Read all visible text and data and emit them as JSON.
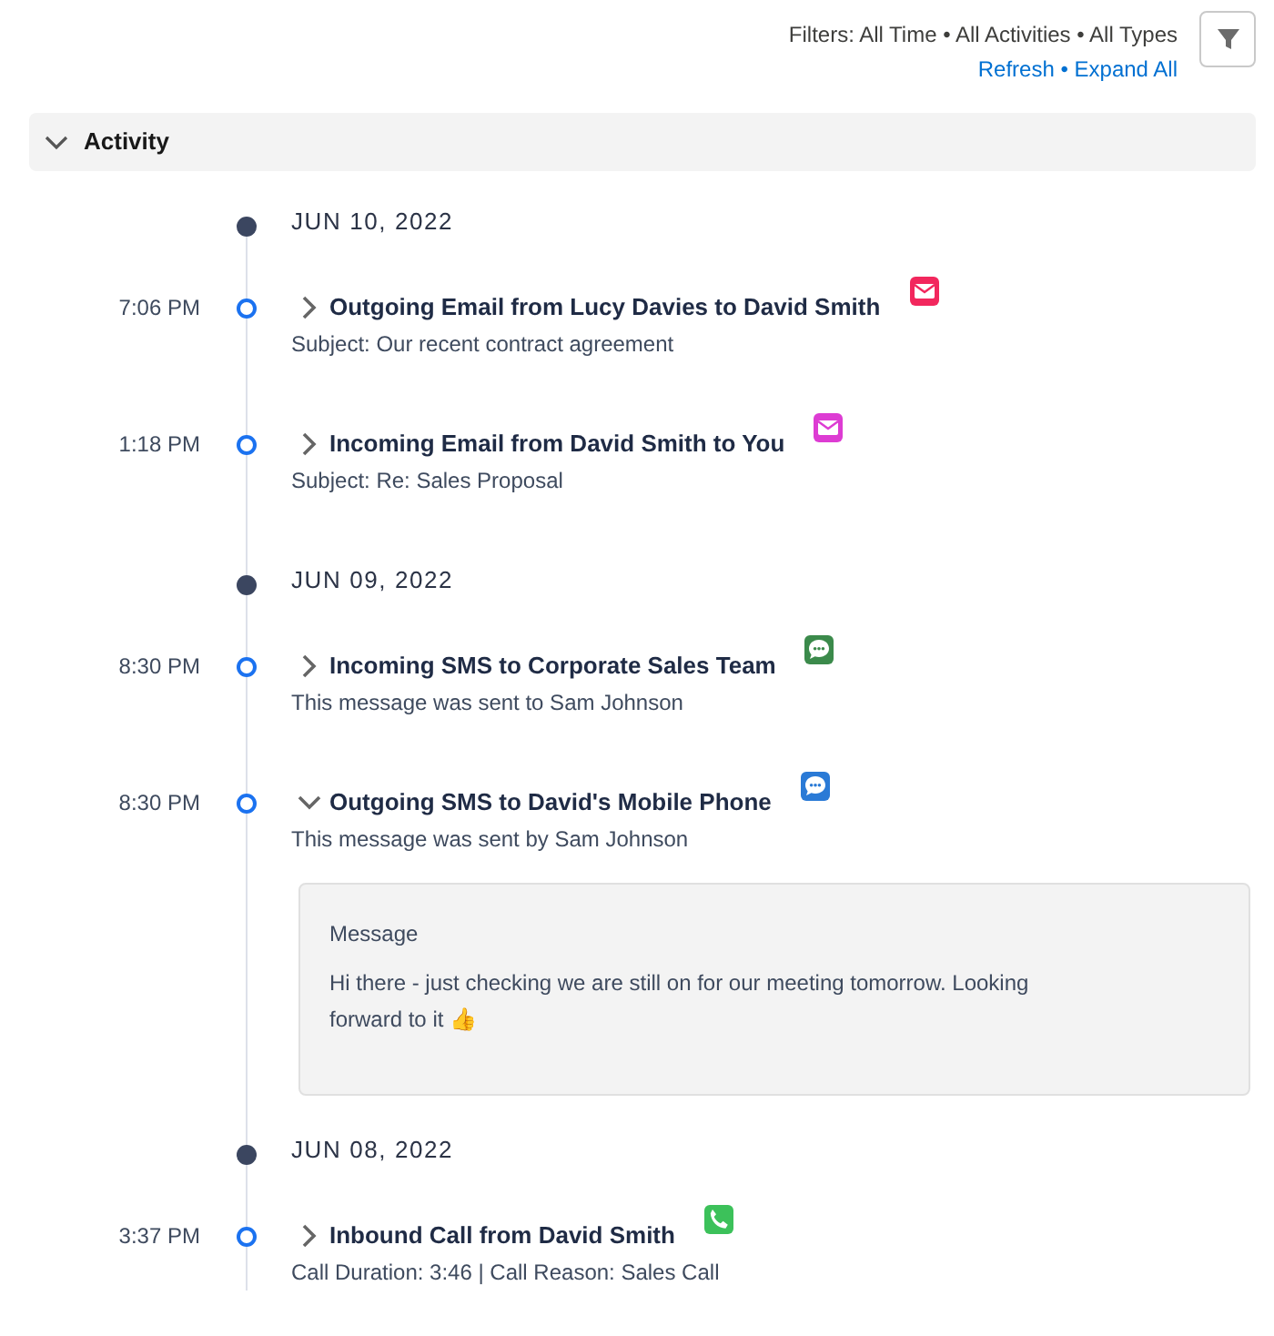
{
  "filters": {
    "summary": "Filters: All Time • All Activities • All Types",
    "links": [
      "Refresh",
      "Expand All"
    ],
    "separator": "•"
  },
  "section": {
    "title": "Activity",
    "expanded": true
  },
  "groups": [
    {
      "date": "JUN 10, 2022",
      "items": [
        {
          "time": "7:06 PM",
          "title": "Outgoing Email from Lucy Davies to David Smith",
          "subtitle": "Subject: Our recent contract agreement",
          "kind": "email",
          "color": "#f2275d",
          "expanded": false
        },
        {
          "time": "1:18 PM",
          "title": "Incoming Email from David Smith to You",
          "subtitle": "Subject: Re: Sales Proposal",
          "kind": "email",
          "color": "#dd3cd3",
          "expanded": false
        }
      ]
    },
    {
      "date": "JUN 09, 2022",
      "items": [
        {
          "time": "8:30 PM",
          "title": "Incoming SMS to Corporate Sales Team",
          "subtitle": "This message was sent to Sam Johnson",
          "kind": "sms",
          "color": "#3b8a4b",
          "expanded": false
        },
        {
          "time": "8:30 PM",
          "title": "Outgoing SMS to David's Mobile Phone",
          "subtitle": "This message was sent by Sam Johnson",
          "kind": "sms",
          "color": "#2a7ad6",
          "expanded": true,
          "detail": {
            "label": "Message",
            "text": "Hi there - just checking we are still on for our meeting tomorrow. Looking forward to it 👍"
          }
        }
      ]
    },
    {
      "date": "JUN 08, 2022",
      "items": [
        {
          "time": "3:37 PM",
          "title": "Inbound Call from David Smith",
          "subtitle": "Call Duration: 3:46 | Call Reason: Sales Call",
          "kind": "call",
          "color": "#3cc15a",
          "expanded": false
        }
      ]
    }
  ]
}
